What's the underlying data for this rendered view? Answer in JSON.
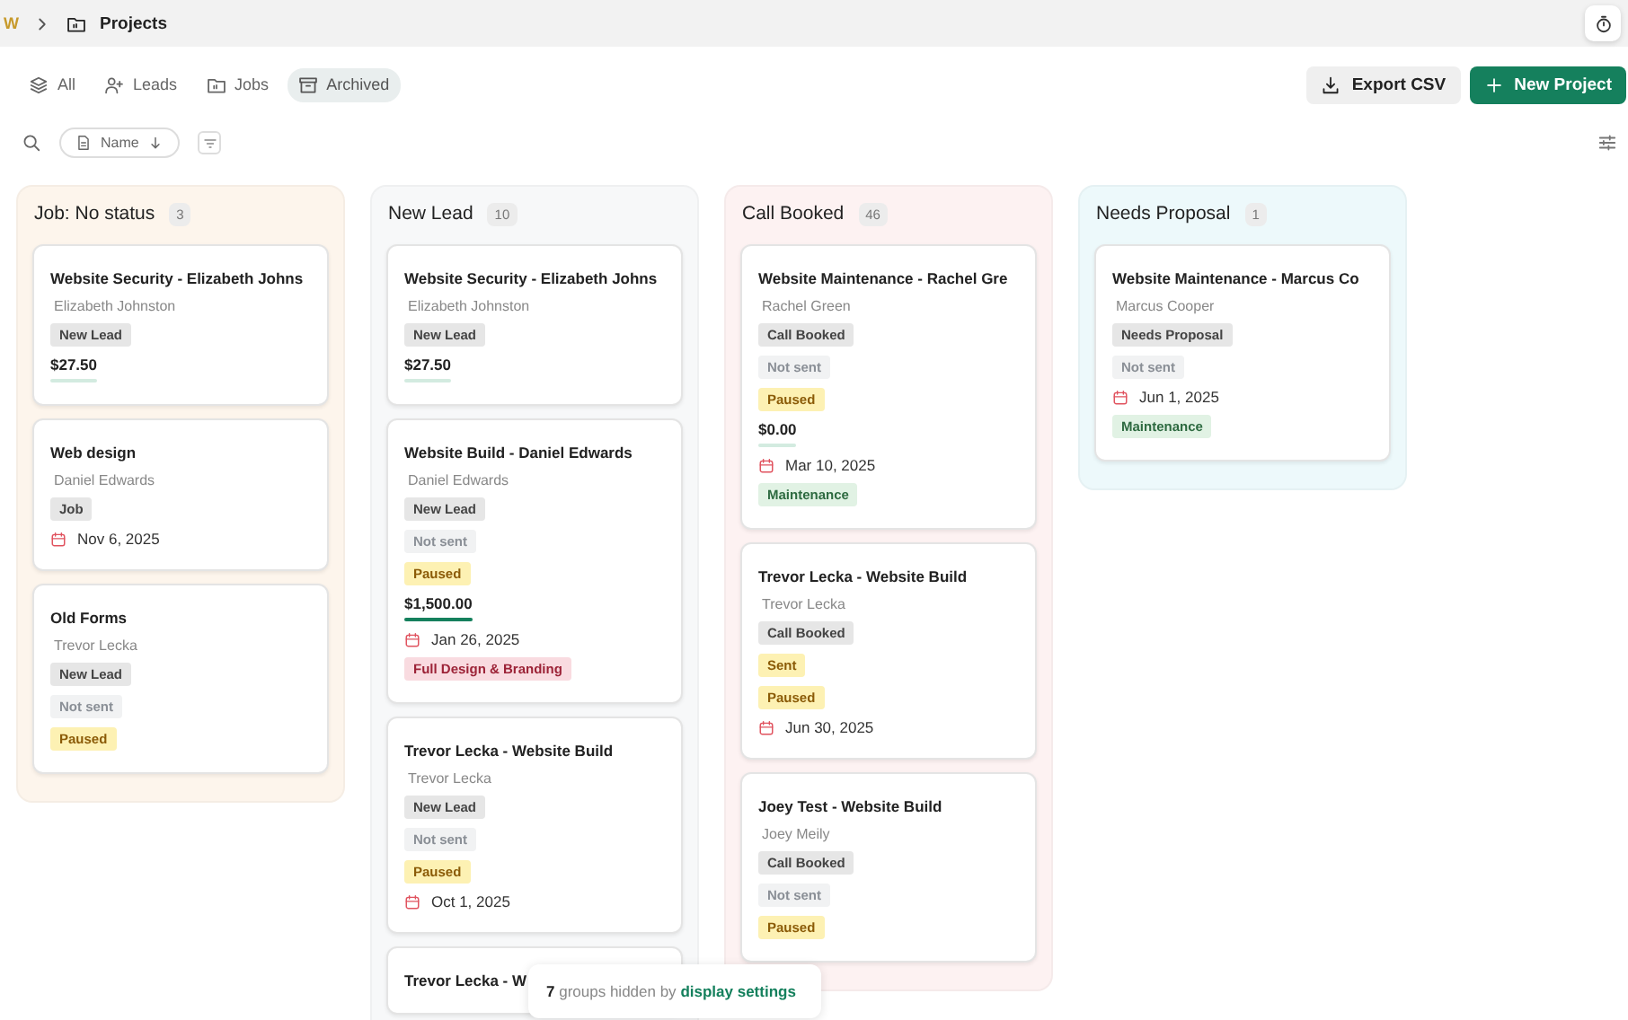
{
  "breadcrumb": {
    "logo": "W",
    "page": "Projects"
  },
  "tabs": [
    {
      "label": "All",
      "selected": false
    },
    {
      "label": "Leads",
      "selected": false
    },
    {
      "label": "Jobs",
      "selected": false
    },
    {
      "label": "Archived",
      "selected": true
    }
  ],
  "actions": [
    {
      "label": "Export CSV",
      "kind": "secondary"
    },
    {
      "label": "New Project",
      "kind": "primary"
    }
  ],
  "sort": {
    "label": "Name"
  },
  "columns": [
    {
      "title": "Job: No status",
      "count": "3",
      "color": "#fdf5ec",
      "cards": [
        {
          "title": "Website Security - Elizabeth Johns",
          "client": "Elizabeth Johnston",
          "tags": [
            {
              "label": "New Lead",
              "kind": "stage"
            }
          ],
          "price": "$27.50",
          "level": 0
        },
        {
          "title": "Web design",
          "client": "Daniel Edwards",
          "tags": [
            {
              "label": "Job",
              "kind": "stage"
            }
          ],
          "date": "Nov 6, 2025"
        },
        {
          "title": "Old Forms",
          "client": "Trevor Lecka",
          "tags": [
            {
              "label": "New Lead",
              "kind": "stage"
            },
            {
              "label": "Not sent",
              "kind": "muted"
            },
            {
              "label": "Paused",
              "kind": "warning"
            }
          ]
        }
      ]
    },
    {
      "title": "New Lead",
      "count": "10",
      "color": "#f7f8f9",
      "cards": [
        {
          "title": "Website Security - Elizabeth Johns",
          "client": "Elizabeth Johnston",
          "tags": [
            {
              "label": "New Lead",
              "kind": "stage"
            }
          ],
          "price": "$27.50",
          "level": 0
        },
        {
          "title": "Website Build - Daniel Edwards",
          "client": "Daniel Edwards",
          "tags": [
            {
              "label": "New Lead",
              "kind": "stage"
            },
            {
              "label": "Not sent",
              "kind": "muted"
            },
            {
              "label": "Paused",
              "kind": "warning"
            }
          ],
          "price": "$1,500.00",
          "level": 1,
          "date": "Jan 26, 2025",
          "extra": [
            {
              "label": "Full Design & Branding",
              "kind": "danger"
            }
          ]
        },
        {
          "title": "Trevor Lecka - Website Build",
          "client": "Trevor Lecka",
          "tags": [
            {
              "label": "New Lead",
              "kind": "stage"
            },
            {
              "label": "Not sent",
              "kind": "muted"
            },
            {
              "label": "Paused",
              "kind": "warning"
            }
          ],
          "date": "Oct 1, 2025"
        },
        {
          "title": "Trevor Lecka - W"
        }
      ]
    },
    {
      "title": "Call Booked",
      "count": "46",
      "color": "#fdf2f2",
      "cards": [
        {
          "title": "Website Maintenance - Rachel Gre",
          "client": "Rachel Green",
          "tags": [
            {
              "label": "Call Booked",
              "kind": "stage"
            },
            {
              "label": "Not sent",
              "kind": "muted"
            },
            {
              "label": "Paused",
              "kind": "warning"
            }
          ],
          "price": "$0.00",
          "level": 0,
          "date": "Mar 10, 2025",
          "extra": [
            {
              "label": "Maintenance",
              "kind": "success"
            }
          ]
        },
        {
          "title": "Trevor Lecka - Website Build",
          "client": "Trevor Lecka",
          "tags": [
            {
              "label": "Call Booked",
              "kind": "stage"
            },
            {
              "label": "Sent",
              "kind": "warning"
            },
            {
              "label": "Paused",
              "kind": "warning"
            }
          ],
          "date": "Jun 30, 2025"
        },
        {
          "title": "Joey Test - Website Build",
          "client": "Joey Meily",
          "tags": [
            {
              "label": "Call Booked",
              "kind": "stage"
            },
            {
              "label": "Not sent",
              "kind": "muted"
            },
            {
              "label": "Paused",
              "kind": "warning"
            }
          ]
        }
      ]
    },
    {
      "title": "Needs Proposal",
      "count": "1",
      "color": "#edf9fb",
      "cards": [
        {
          "title": "Website Maintenance - Marcus Co",
          "client": "Marcus Cooper",
          "tags": [
            {
              "label": "Needs Proposal",
              "kind": "stage"
            },
            {
              "label": "Not sent",
              "kind": "muted"
            }
          ],
          "date": "Jun 1, 2025",
          "extra": [
            {
              "label": "Maintenance",
              "kind": "success"
            }
          ]
        }
      ]
    }
  ],
  "toast": {
    "text": "**7** groups hidden by",
    "link": "display settings"
  }
}
